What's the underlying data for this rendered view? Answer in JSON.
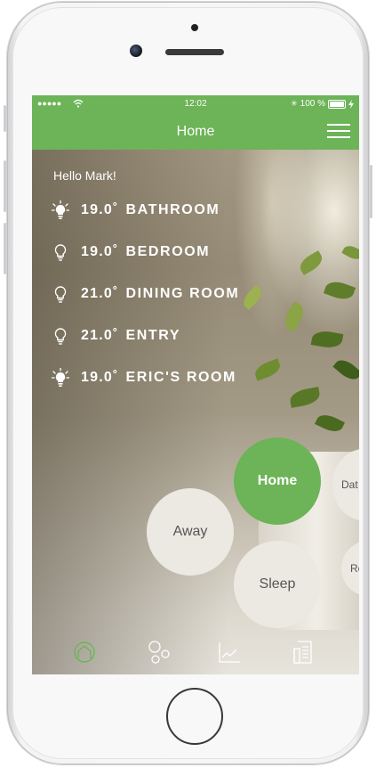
{
  "status_bar": {
    "signal": "●●●●●",
    "time": "12:02",
    "bluetooth": "✳",
    "battery_percent": "100 %"
  },
  "nav": {
    "title": "Home"
  },
  "greeting": "Hello Mark!",
  "rooms": [
    {
      "temp": "19.0˚",
      "name": "BATHROOM",
      "light": "on"
    },
    {
      "temp": "19.0˚",
      "name": "BEDROOM",
      "light": "off"
    },
    {
      "temp": "21.0˚",
      "name": "DINING ROOM",
      "light": "off"
    },
    {
      "temp": "21.0˚",
      "name": "ENTRY",
      "light": "off"
    },
    {
      "temp": "19.0˚",
      "name": "ERIC'S ROOM",
      "light": "on"
    }
  ],
  "modes": {
    "home": "Home",
    "away": "Away",
    "sleep": "Sleep",
    "date": "Dat",
    "re": "Re"
  },
  "tabs": [
    {
      "icon": "home-tab-icon",
      "active": true
    },
    {
      "icon": "rooms-tab-icon",
      "active": false
    },
    {
      "icon": "stats-tab-icon",
      "active": false
    },
    {
      "icon": "log-tab-icon",
      "active": false
    }
  ],
  "colors": {
    "accent": "#6db358",
    "bubble": "#ece9e2"
  }
}
